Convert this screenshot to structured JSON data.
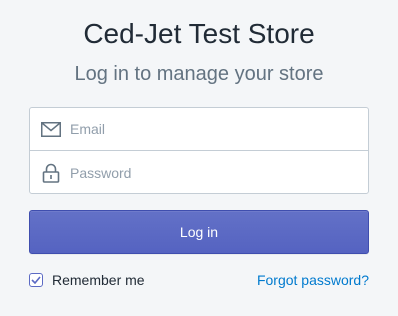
{
  "store": {
    "title": "Ced-Jet Test Store",
    "subtitle": "Log in to manage your store"
  },
  "form": {
    "email": {
      "placeholder": "Email",
      "value": "",
      "icon": "envelope-icon"
    },
    "password": {
      "placeholder": "Password",
      "value": "",
      "icon": "lock-icon"
    },
    "login_label": "Log in",
    "remember_label": "Remember me",
    "remember_checked": true,
    "forgot_label": "Forgot password?"
  },
  "colors": {
    "background": "#f4f6f8",
    "primary": "#5c6ac4",
    "link": "#007ace",
    "title": "#212b36",
    "subtitle": "#637381"
  }
}
